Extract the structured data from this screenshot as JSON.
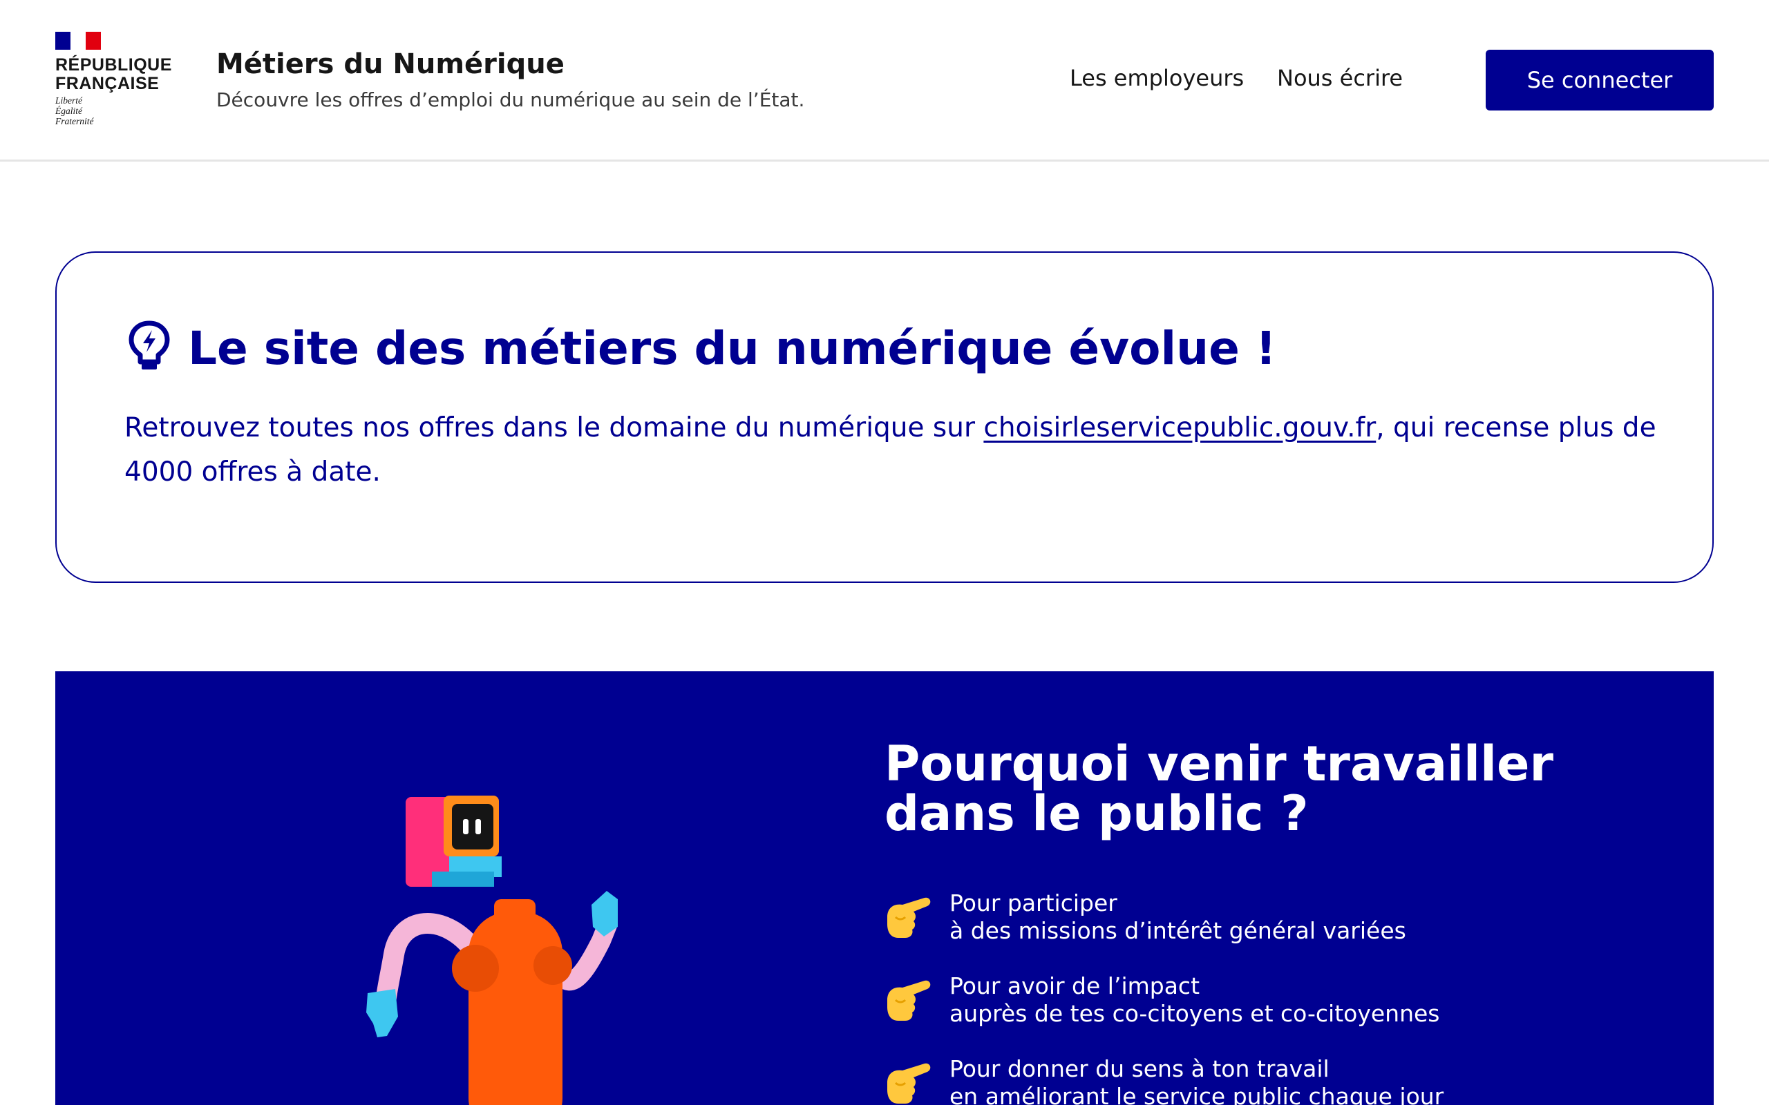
{
  "header": {
    "logo": {
      "name_lines": [
        "RÉPUBLIQUE",
        "FRANÇAISE"
      ],
      "motto_lines": [
        "Liberté",
        "Égalité",
        "Fraternité"
      ]
    },
    "site_title": "Métiers du Numérique",
    "tagline": "Découvre les offres d’emploi du numérique au sein de l’État.",
    "nav": {
      "employers": "Les employeurs",
      "contact": "Nous écrire"
    },
    "login_label": "Se connecter"
  },
  "notice": {
    "icon": "lightbulb-flash-icon",
    "title": "Le site des métiers du numérique évolue !",
    "text_before": "Retrouvez toutes nos offres dans le domaine du numérique sur ",
    "link_text": "choisirleservicepublic.gouv.fr",
    "text_after": ", qui recense plus de 4000 offres à date."
  },
  "why": {
    "title_lines": [
      "Pourquoi venir travailler",
      "dans le public ?"
    ],
    "items": [
      {
        "icon": "pointing-hand-icon",
        "line1": "Pour participer",
        "line2": "à des missions d’intérêt général variées"
      },
      {
        "icon": "pointing-hand-icon",
        "line1": "Pour avoir de l’impact",
        "line2": "auprès de tes co-citoyens et co-citoyennes"
      },
      {
        "icon": "pointing-hand-icon",
        "line1": "Pour donner du sens à ton travail",
        "line2": "en améliorant le service public chaque jour"
      }
    ]
  },
  "colors": {
    "primary": "#000091",
    "marianne_red": "#e1000f",
    "text": "#161616",
    "background": "#ffffff"
  }
}
